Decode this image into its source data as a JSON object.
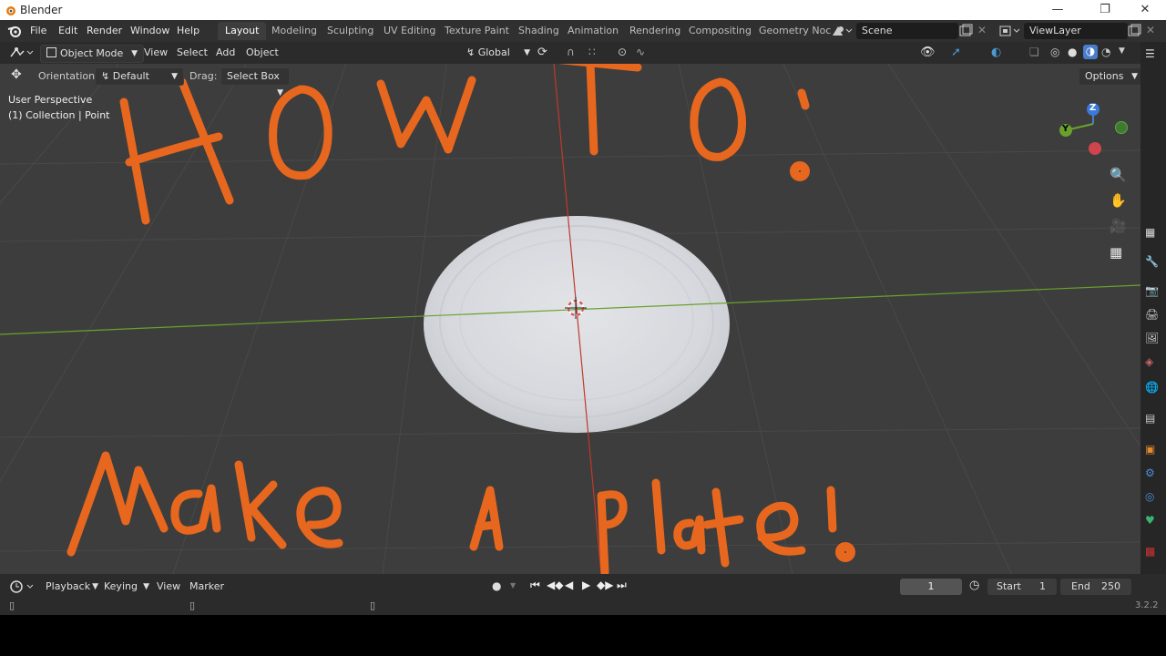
{
  "window": {
    "title": "Blender"
  },
  "menu": {
    "file": "File",
    "edit": "Edit",
    "render": "Render",
    "window": "Window",
    "help": "Help"
  },
  "workspaces": [
    "Layout",
    "Modeling",
    "Sculpting",
    "UV Editing",
    "Texture Paint",
    "Shading",
    "Animation",
    "Rendering",
    "Compositing",
    "Geometry Noc"
  ],
  "scene": {
    "name": "Scene",
    "viewlayer": "ViewLayer"
  },
  "header": {
    "mode": "Object Mode",
    "view": "View",
    "select": "Select",
    "add": "Add",
    "object": "Object",
    "transform": "Global",
    "options": "Options"
  },
  "toolsettings": {
    "orientation_label": "Orientation:",
    "orientation_value": "Default",
    "drag_label": "Drag:",
    "drag_value": "Select Box"
  },
  "viewport_info": {
    "perspective": "User Perspective",
    "collection": "(1) Collection | Point"
  },
  "gizmo": {
    "z": "Z",
    "y": "Y"
  },
  "annotation": {
    "line1": "HOW TO:",
    "line2": "Make A Plate!"
  },
  "timeline": {
    "playback": "Playback",
    "keying": "Keying",
    "view": "View",
    "marker": "Marker",
    "current_frame": "1",
    "start_label": "Start",
    "start_value": "1",
    "end_label": "End",
    "end_value": "250"
  },
  "status": {
    "version": "3.2.2"
  },
  "colors": {
    "annotation": "#e8671e",
    "x_axis": "#c0392b",
    "y_axis": "#6aa12c",
    "accent": "#4a7ccc"
  }
}
